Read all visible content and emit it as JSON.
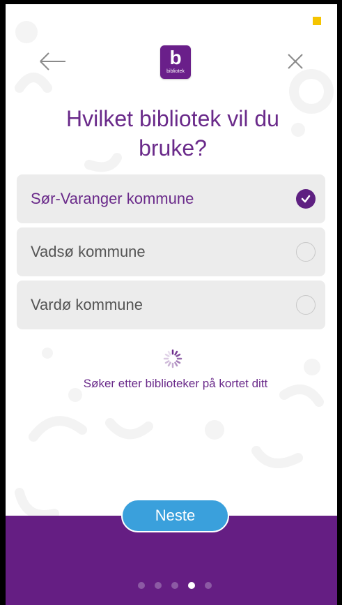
{
  "header": {
    "back_icon": "arrow-left-icon",
    "close_icon": "close-icon",
    "logo_text": "bibliotek"
  },
  "title": "Hvilket bibliotek vil du bruke?",
  "options": [
    {
      "label": "Sør-Varanger kommune",
      "selected": true
    },
    {
      "label": "Vadsø kommune",
      "selected": false
    },
    {
      "label": "Vardø kommune",
      "selected": false
    }
  ],
  "status_text": "Søker etter biblioteker på kortet ditt",
  "next_button": "Neste",
  "pager": {
    "total": 5,
    "current": 4
  },
  "colors": {
    "brand_purple": "#651e83",
    "title_purple": "#6a2a8a",
    "button_blue": "#3aa0dc",
    "status_yellow": "#f5c400"
  }
}
